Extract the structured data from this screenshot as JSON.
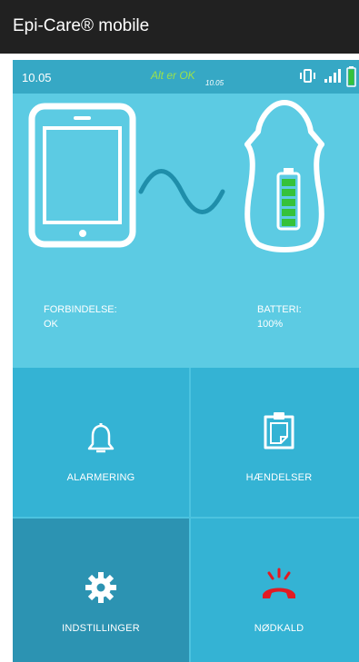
{
  "app": {
    "title": "Epi-Care® mobile"
  },
  "status": {
    "time": "10.05",
    "state_text": "Alt er OK",
    "state_time": "10.05",
    "icons": [
      "vibrate-icon",
      "signal-icon",
      "battery-icon"
    ]
  },
  "connection": {
    "label": "FORBINDELSE:",
    "value": "OK"
  },
  "battery": {
    "label": "BATTERI:",
    "value": "100%",
    "level_fraction": 1.0
  },
  "tiles": [
    {
      "label": "ALARMERING",
      "icon": "bell-icon"
    },
    {
      "label": "HÆNDELSER",
      "icon": "clipboard-icon"
    },
    {
      "label": "INDSTILLINGER",
      "icon": "gear-icon"
    },
    {
      "label": "NØDKALD",
      "icon": "emergency-phone-icon"
    }
  ],
  "colors": {
    "appbar": "#212121",
    "hero": "#5ccbe3",
    "tile": "#34b3d4",
    "tile_dark": "#2c93b2",
    "ok_text": "#9be14b",
    "battery_green": "#35c23a",
    "emergency_red": "#e21b23",
    "wave": "#1f8eaa"
  }
}
